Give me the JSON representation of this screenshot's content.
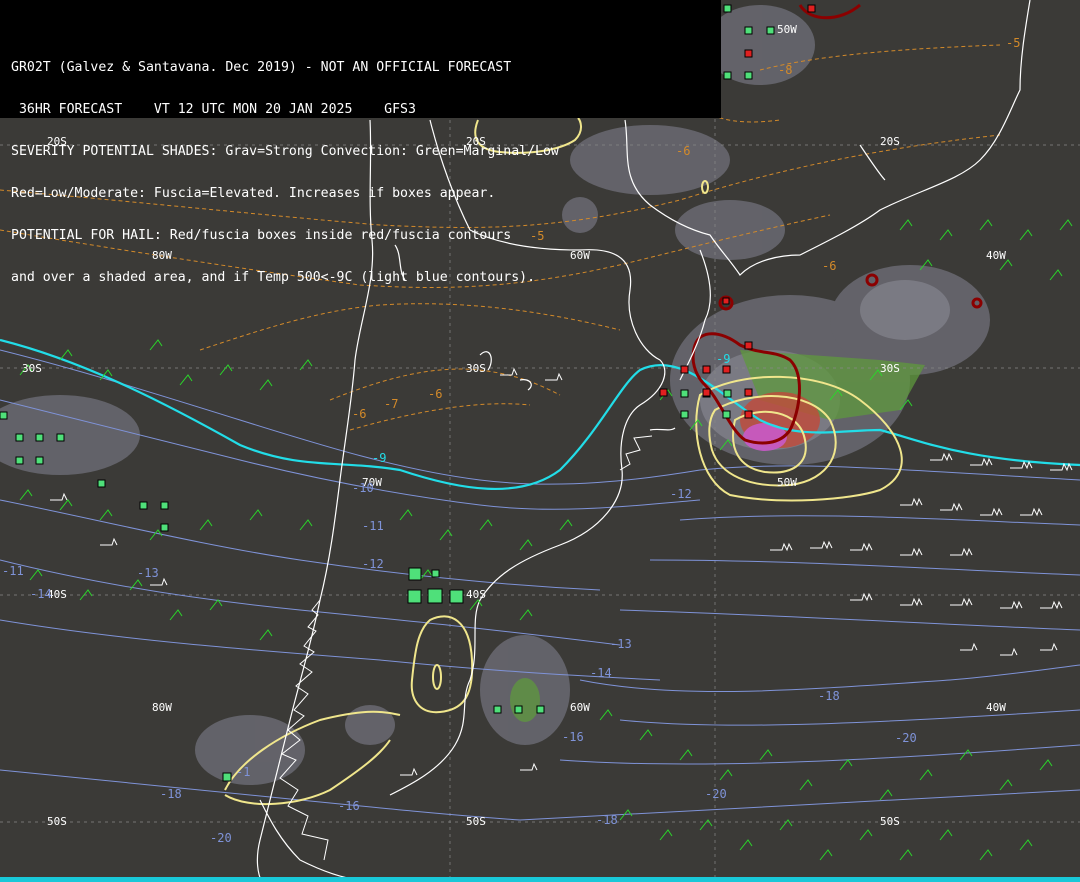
{
  "header": {
    "lines": [
      "GR02T (Galvez & Santavana. Dec 2019) - NOT AN OFFICIAL FORECAST",
      " 36HR FORECAST    VT 12 UTC MON 20 JAN 2025    GFS3",
      "SEVERITY POTENTIAL SHADES: Grav=Strong Convection: Green=Marginal/Low",
      "Red=Low/Moderate: Fuscia=Elevated. Increases if boxes appear.",
      "POTENTIAL FOR HAIL: Red/fuscia boxes inside red/fuscia contours",
      "and over a shaded area, and if Temp 500<-9C (light blue contours)."
    ]
  },
  "grid_labels": {
    "lat": [
      "20S",
      "20S",
      "20S",
      "30S",
      "30S",
      "30S",
      "40S",
      "40S",
      "50S",
      "50S",
      "50S"
    ],
    "lon": [
      "80W",
      "60W",
      "50W",
      "40W",
      "70W",
      "80W",
      "60W",
      "50W",
      "40W"
    ]
  },
  "isotherm_labels": {
    "orange": [
      "-5",
      "-6",
      "-6",
      "-7",
      "-6",
      "-8",
      "-5",
      "-6"
    ],
    "blue": [
      "-9",
      "-9",
      "-10",
      "-11",
      "-12",
      "-13",
      "-14",
      "-13",
      "-14",
      "-12",
      "-11",
      "-16",
      "-18",
      "-18",
      "-20",
      "-20",
      "-20",
      "-18",
      "-16",
      "-1"
    ]
  },
  "colors": {
    "background": "#3b3a37",
    "coast": "#ffffff",
    "wind_barbs": "#2bd62b",
    "light_blue_isotherm": "#22dde8",
    "orange_isotherm": "#d38a2a",
    "blue_isotherm": "#7f93d8",
    "yellow_contour": "#f0e68c",
    "red_contour": "#8b0000",
    "green_box": "#4fe07a",
    "red_box": "#e02020",
    "bottom_bar": "#19c8d8"
  }
}
